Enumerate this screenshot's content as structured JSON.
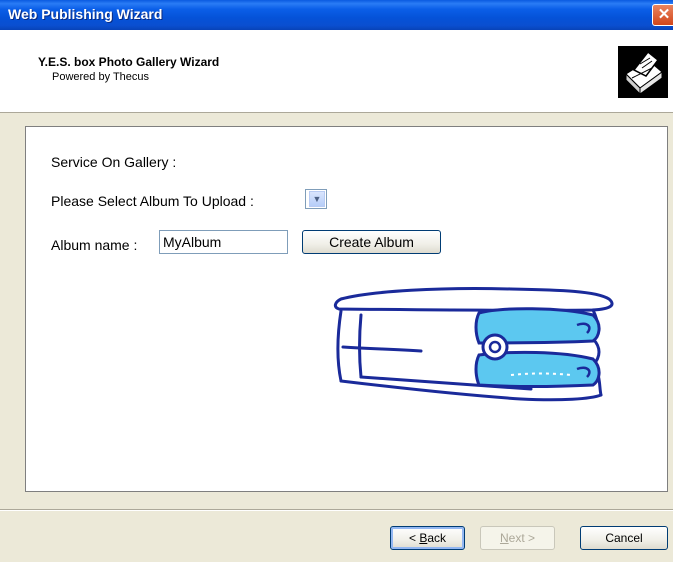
{
  "window": {
    "title": "Web Publishing Wizard",
    "close_glyph": "✕"
  },
  "header": {
    "title": "Y.E.S. box Photo Gallery Wizard",
    "subtitle": "Powered by Thecus",
    "icon": "printer-publish-icon"
  },
  "form": {
    "service_label": "Service On Gallery :",
    "album_select_label": "Please Select Album To Upload :",
    "album_select_value": "",
    "album_name_label": "Album name :",
    "album_name_value": "MyAlbum",
    "create_album_label": "Create Album"
  },
  "illustration": {
    "icon": "nas-storage-device-illustration"
  },
  "buttons": {
    "back_prefix": "< ",
    "back_mnemonic": "B",
    "back_rest": "ack",
    "next_prefix": "",
    "next_mnemonic": "N",
    "next_rest": "ext >",
    "cancel_label": "Cancel"
  },
  "colors": {
    "titlebar": "#0a55dc",
    "window_bg": "#ece9d8",
    "drawing_blue": "#1a2a9a",
    "drawing_fill": "#5cc8f0"
  }
}
